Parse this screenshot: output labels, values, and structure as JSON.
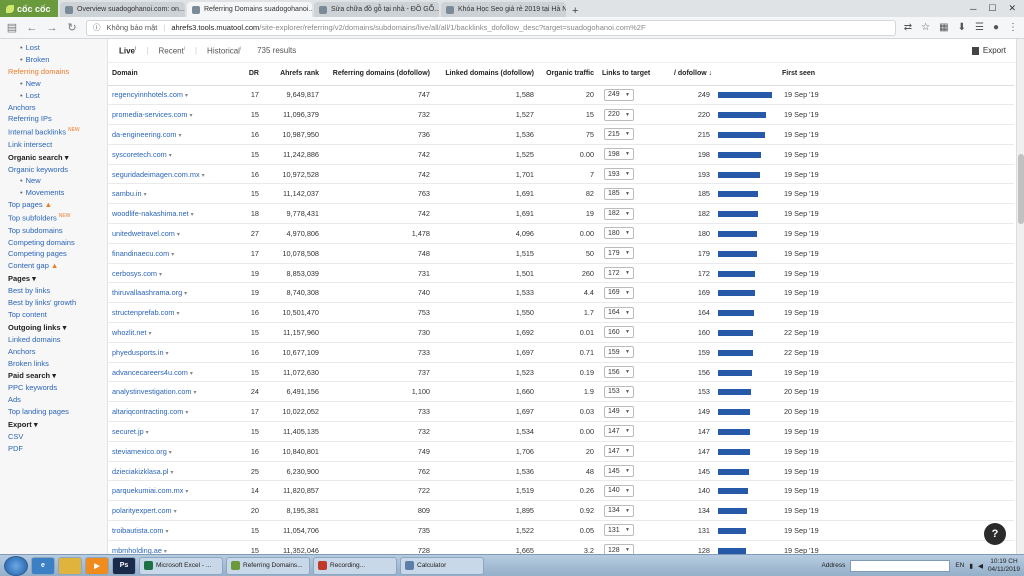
{
  "browser": {
    "brand": "cốc cốc",
    "tabs": [
      {
        "label": "Overview suadogohanoi.com: on...",
        "active": false
      },
      {
        "label": "Referring Domains suadogohanoi...",
        "active": true
      },
      {
        "label": "Sửa chữa đồ gỗ tại nhà - ĐỒ GỖ...",
        "active": false
      },
      {
        "label": "Khóa Học Seo giá rẻ 2019 tại Hà N...",
        "active": false
      }
    ],
    "new_tab": "+",
    "security_label": "Không bảo mật",
    "url_host": "ahrefs3.tools.muatool.com",
    "url_path": "/site-explorer/referring/v2/domains/subdomains/live/all/all/1/backlinks_dofollow_desc?target=suadogohanoi.com%2F"
  },
  "sidebar": {
    "items": [
      {
        "label": "Lost",
        "type": "sub"
      },
      {
        "label": "Broken",
        "type": "sub"
      },
      {
        "label": "Referring domains",
        "type": "active"
      },
      {
        "label": "New",
        "type": "sub"
      },
      {
        "label": "Lost",
        "type": "sub"
      },
      {
        "label": "Anchors",
        "type": "link"
      },
      {
        "label": "Referring IPs",
        "type": "link"
      },
      {
        "label": "Internal backlinks",
        "type": "link",
        "badge": "NEW"
      },
      {
        "label": "Link intersect",
        "type": "link"
      },
      {
        "label": "Organic search ▾",
        "type": "hdr"
      },
      {
        "label": "Organic keywords",
        "type": "link"
      },
      {
        "label": "New",
        "type": "sub"
      },
      {
        "label": "Movements",
        "type": "sub"
      },
      {
        "label": "Top pages",
        "type": "link",
        "fire": true
      },
      {
        "label": "Top subfolders",
        "type": "link",
        "badge": "NEW"
      },
      {
        "label": "Top subdomains",
        "type": "link"
      },
      {
        "label": "Competing domains",
        "type": "link"
      },
      {
        "label": "Competing pages",
        "type": "link"
      },
      {
        "label": "Content gap",
        "type": "link",
        "fire": true
      },
      {
        "label": "Pages ▾",
        "type": "hdr"
      },
      {
        "label": "Best by links",
        "type": "link"
      },
      {
        "label": "Best by links' growth",
        "type": "link"
      },
      {
        "label": "Top content",
        "type": "link"
      },
      {
        "label": "Outgoing links ▾",
        "type": "hdr"
      },
      {
        "label": "Linked domains",
        "type": "link"
      },
      {
        "label": "Anchors",
        "type": "link"
      },
      {
        "label": "Broken links",
        "type": "link"
      },
      {
        "label": "Paid search ▾",
        "type": "hdr"
      },
      {
        "label": "PPC keywords",
        "type": "link"
      },
      {
        "label": "Ads",
        "type": "link"
      },
      {
        "label": "Top landing pages",
        "type": "link"
      },
      {
        "label": "Export ▾",
        "type": "hdr"
      },
      {
        "label": "CSV",
        "type": "link"
      },
      {
        "label": "PDF",
        "type": "link"
      }
    ]
  },
  "filters": {
    "live": "Live",
    "recent": "Recent",
    "historical": "Historical",
    "results": "735 results",
    "export": "Export"
  },
  "table": {
    "columns": [
      "Domain",
      "DR",
      "Ahrefs rank",
      "Referring domains (dofollow)",
      "Linked domains (dofollow)",
      "Organic traffic",
      "Links to target",
      "/ dofollow ↓",
      "",
      "First seen"
    ],
    "max_dofollow": 249,
    "rows": [
      {
        "domain": "regencyinnhotels.com",
        "dr": "17",
        "rank": "9,649,817",
        "ref": "747",
        "linked": "1,588",
        "traffic": "20",
        "links": "249",
        "dofollow": "249",
        "first": "19 Sep '19"
      },
      {
        "domain": "promedia-services.com",
        "dr": "15",
        "rank": "11,096,379",
        "ref": "732",
        "linked": "1,527",
        "traffic": "15",
        "links": "220",
        "dofollow": "220",
        "first": "19 Sep '19"
      },
      {
        "domain": "da-engineering.com",
        "dr": "16",
        "rank": "10,987,950",
        "ref": "736",
        "linked": "1,536",
        "traffic": "75",
        "links": "215",
        "dofollow": "215",
        "first": "19 Sep '19"
      },
      {
        "domain": "syscoretech.com",
        "dr": "15",
        "rank": "11,242,886",
        "ref": "742",
        "linked": "1,525",
        "traffic": "0.00",
        "links": "198",
        "dofollow": "198",
        "first": "19 Sep '19"
      },
      {
        "domain": "seguridadeimagen.com.mx",
        "dr": "16",
        "rank": "10,972,528",
        "ref": "742",
        "linked": "1,701",
        "traffic": "7",
        "links": "193",
        "dofollow": "193",
        "first": "19 Sep '19"
      },
      {
        "domain": "sambu.in",
        "dr": "15",
        "rank": "11,142,037",
        "ref": "763",
        "linked": "1,691",
        "traffic": "82",
        "links": "185",
        "dofollow": "185",
        "first": "19 Sep '19"
      },
      {
        "domain": "woodlife-nakashima.net",
        "dr": "18",
        "rank": "9,778,431",
        "ref": "742",
        "linked": "1,691",
        "traffic": "19",
        "links": "182",
        "dofollow": "182",
        "first": "19 Sep '19"
      },
      {
        "domain": "unitedwetravel.com",
        "dr": "27",
        "rank": "4,970,806",
        "ref": "1,478",
        "linked": "4,096",
        "traffic": "0.00",
        "links": "180",
        "dofollow": "180",
        "first": "19 Sep '19"
      },
      {
        "domain": "finandinaecu.com",
        "dr": "17",
        "rank": "10,078,508",
        "ref": "748",
        "linked": "1,515",
        "traffic": "50",
        "links": "179",
        "dofollow": "179",
        "first": "19 Sep '19"
      },
      {
        "domain": "cerbosys.com",
        "dr": "19",
        "rank": "8,853,039",
        "ref": "731",
        "linked": "1,501",
        "traffic": "260",
        "links": "172",
        "dofollow": "172",
        "first": "19 Sep '19"
      },
      {
        "domain": "thiruvallaashrama.org",
        "dr": "19",
        "rank": "8,740,308",
        "ref": "740",
        "linked": "1,533",
        "traffic": "4.4",
        "links": "169",
        "dofollow": "169",
        "first": "19 Sep '19"
      },
      {
        "domain": "structenprefab.com",
        "dr": "16",
        "rank": "10,501,470",
        "ref": "753",
        "linked": "1,550",
        "traffic": "1.7",
        "links": "164",
        "dofollow": "164",
        "first": "19 Sep '19"
      },
      {
        "domain": "whozlit.net",
        "dr": "15",
        "rank": "11,157,960",
        "ref": "730",
        "linked": "1,692",
        "traffic": "0.01",
        "links": "160",
        "dofollow": "160",
        "first": "22 Sep '19"
      },
      {
        "domain": "phyedusports.in",
        "dr": "16",
        "rank": "10,677,109",
        "ref": "733",
        "linked": "1,697",
        "traffic": "0.71",
        "links": "159",
        "dofollow": "159",
        "first": "22 Sep '19"
      },
      {
        "domain": "advancecareers4u.com",
        "dr": "15",
        "rank": "11,072,630",
        "ref": "737",
        "linked": "1,523",
        "traffic": "0.19",
        "links": "156",
        "dofollow": "156",
        "first": "19 Sep '19"
      },
      {
        "domain": "analystinvestigation.com",
        "dr": "24",
        "rank": "6,491,156",
        "ref": "1,100",
        "linked": "1,660",
        "traffic": "1.9",
        "links": "153",
        "dofollow": "153",
        "first": "20 Sep '19"
      },
      {
        "domain": "altariqcontracting.com",
        "dr": "17",
        "rank": "10,022,052",
        "ref": "733",
        "linked": "1,697",
        "traffic": "0.03",
        "links": "149",
        "dofollow": "149",
        "first": "20 Sep '19"
      },
      {
        "domain": "securet.jp",
        "dr": "15",
        "rank": "11,405,135",
        "ref": "732",
        "linked": "1,534",
        "traffic": "0.00",
        "links": "147",
        "dofollow": "147",
        "first": "19 Sep '19"
      },
      {
        "domain": "steviamexico.org",
        "dr": "16",
        "rank": "10,840,801",
        "ref": "749",
        "linked": "1,706",
        "traffic": "20",
        "links": "147",
        "dofollow": "147",
        "first": "19 Sep '19"
      },
      {
        "domain": "dzieciakizklasa.pl",
        "dr": "25",
        "rank": "6,230,900",
        "ref": "762",
        "linked": "1,536",
        "traffic": "48",
        "links": "145",
        "dofollow": "145",
        "first": "19 Sep '19"
      },
      {
        "domain": "parquekumiai.com.mx",
        "dr": "14",
        "rank": "11,820,857",
        "ref": "722",
        "linked": "1,519",
        "traffic": "0.26",
        "links": "140",
        "dofollow": "140",
        "first": "19 Sep '19"
      },
      {
        "domain": "polarityexpert.com",
        "dr": "20",
        "rank": "8,195,381",
        "ref": "809",
        "linked": "1,895",
        "traffic": "0.92",
        "links": "134",
        "dofollow": "134",
        "first": "19 Sep '19"
      },
      {
        "domain": "troibautista.com",
        "dr": "15",
        "rank": "11,054,706",
        "ref": "735",
        "linked": "1,522",
        "traffic": "0.05",
        "links": "131",
        "dofollow": "131",
        "first": "19 Sep '19"
      },
      {
        "domain": "mbmholding.ae",
        "dr": "15",
        "rank": "11,352,046",
        "ref": "728",
        "linked": "1,665",
        "traffic": "3.2",
        "links": "128",
        "dofollow": "128",
        "first": "19 Sep '19"
      }
    ]
  },
  "help": "?",
  "taskbar": {
    "apps": [
      {
        "label": "Microsoft Excel - ...",
        "color": "#1e7145"
      },
      {
        "label": "Referring Domains...",
        "color": "#6a9a3b"
      },
      {
        "label": "Recording...",
        "color": "#c0392b"
      },
      {
        "label": "Calculator",
        "color": "#5b7fa6"
      }
    ],
    "address_label": "Address",
    "lang": "EN",
    "time": "10:19 CH",
    "date": "04/11/2019"
  },
  "colors": {
    "bar": "#2659a8",
    "accent": "#f07a2b",
    "link": "#2a64b8"
  }
}
